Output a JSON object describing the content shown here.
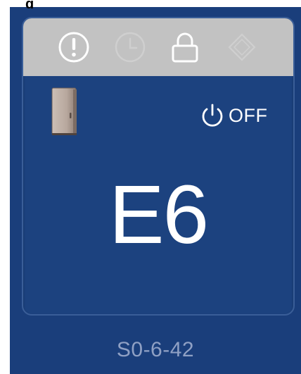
{
  "header": {
    "title_fragment": "g"
  },
  "status_bar": {
    "icons": [
      {
        "name": "alert-icon",
        "active": true
      },
      {
        "name": "clock-icon",
        "active": false
      },
      {
        "name": "lock-icon",
        "active": true
      },
      {
        "name": "diamond-icon",
        "active": false
      }
    ],
    "active_color": "#ffffff",
    "inactive_color": "#cfcfcf"
  },
  "device": {
    "unit_icon": "cabinet-icon",
    "power_icon": "power-icon",
    "power_label": "OFF",
    "code": "E6",
    "id": "S0-6-42"
  },
  "colors": {
    "panel": "#1a3e7b",
    "card": "#1c427f",
    "status_bar": "#c2c2c2",
    "text": "#ffffff",
    "id_text": "#8fa0c4"
  }
}
